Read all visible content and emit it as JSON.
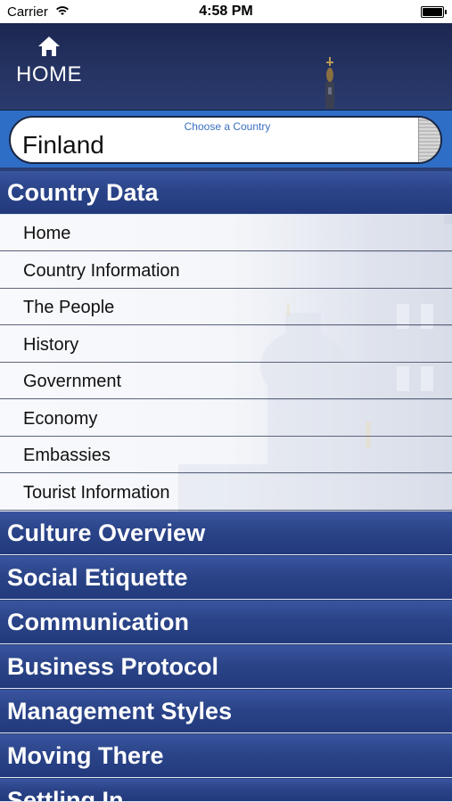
{
  "status_bar": {
    "carrier": "Carrier",
    "time": "4:58 PM",
    "wifi_icon": "wifi-icon",
    "battery_icon": "battery-icon"
  },
  "topbar": {
    "home_label": "HOME",
    "home_icon": "home-icon"
  },
  "country_picker": {
    "hint": "Choose a Country",
    "value": "Finland"
  },
  "country_data": {
    "title": "Country Data",
    "items": [
      "Home",
      "Country Information",
      "The People",
      "History",
      "Government",
      "Economy",
      "Embassies",
      "Tourist Information"
    ]
  },
  "sections": [
    "Culture Overview",
    "Social Etiquette",
    "Communication",
    "Business Protocol",
    "Management Styles",
    "Moving There",
    "Settling In"
  ],
  "colors": {
    "section_blue": "#2b4489",
    "picker_strip": "#2f6ec6",
    "topbar": "#1c2750"
  }
}
